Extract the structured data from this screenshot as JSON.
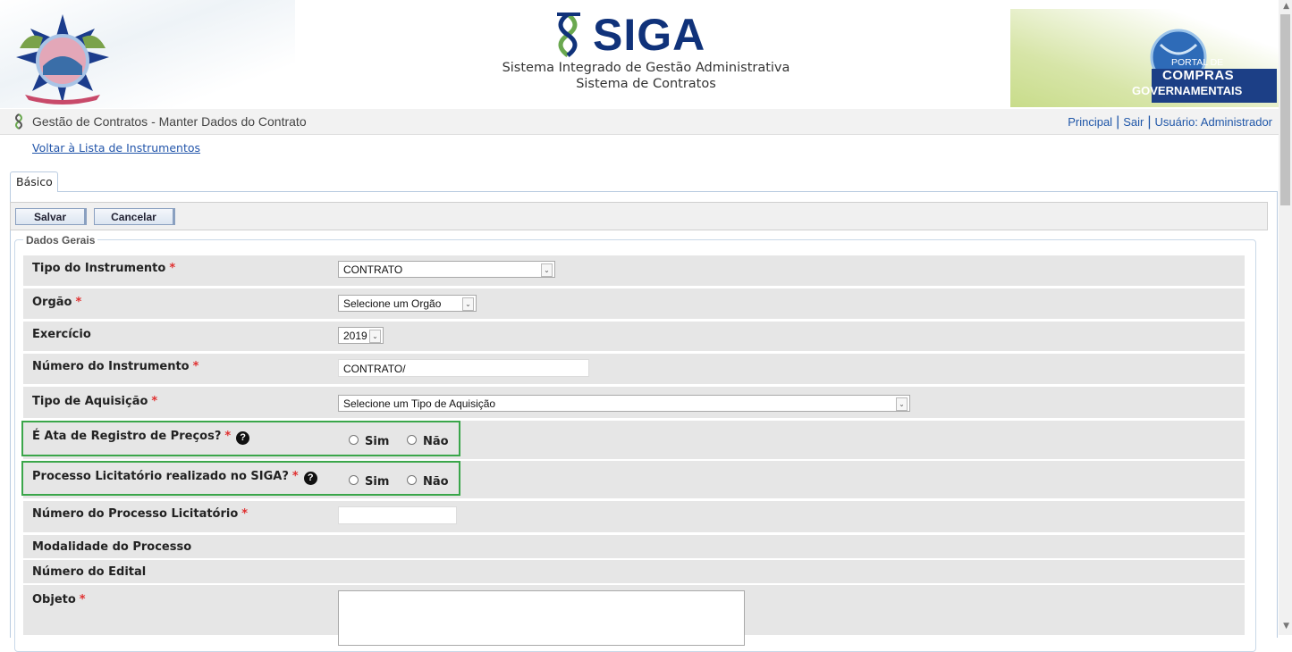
{
  "header": {
    "logo_name": "SIGA",
    "subtitle_1": "Sistema Integrado de Gestão Administrativa",
    "subtitle_2": "Sistema de Contratos",
    "portal_line1": "PORTAL DE",
    "portal_line2": "COMPRAS",
    "portal_line3": "GOVERNAMENTAIS"
  },
  "titlebar": {
    "title": "Gestão de Contratos - Manter Dados do Contrato",
    "links": {
      "principal": "Principal",
      "sep": "|",
      "sair": "Sair",
      "usuario": "Usuário: Administrador"
    }
  },
  "back_link": "Voltar à Lista de Instrumentos",
  "tabs": [
    {
      "label": "Básico",
      "active": true
    }
  ],
  "toolbar": {
    "save_label": "Salvar",
    "cancel_label": "Cancelar"
  },
  "section_title": "Dados Gerais",
  "required_marker": "*",
  "help_glyph": "?",
  "fields": {
    "tipo_instrumento": {
      "label": "Tipo do Instrumento",
      "value": "CONTRATO"
    },
    "orgao": {
      "label": "Orgão",
      "value": "Selecione um Orgão"
    },
    "exercicio": {
      "label": "Exercício",
      "value": "2019"
    },
    "numero_instrumento": {
      "label": "Número do Instrumento",
      "value": "CONTRATO/"
    },
    "tipo_aquisicao": {
      "label": "Tipo de Aquisição",
      "value": "Selecione um Tipo de Aquisição"
    },
    "ata_registro": {
      "label": "É Ata de Registro de Preços?",
      "opt_sim": "Sim",
      "opt_nao": "Não"
    },
    "processo_siga": {
      "label": "Processo Licitatório realizado no SIGA?",
      "opt_sim": "Sim",
      "opt_nao": "Não"
    },
    "numero_processo": {
      "label": "Número do Processo Licitatório",
      "value": ""
    },
    "modalidade": {
      "label": "Modalidade do Processo"
    },
    "numero_edital": {
      "label": "Número do Edital"
    },
    "objeto": {
      "label": "Objeto",
      "value": ""
    }
  },
  "colors": {
    "row_bg": "#e6e6e6",
    "required": "#e03030",
    "highlight_border": "#3aa64a",
    "link": "#1f56a8",
    "brand_blue": "#10327a"
  },
  "icons": {
    "help": "help-icon",
    "select_arrow": "chevron-down-icon",
    "title_logo": "siga-helix-icon"
  }
}
